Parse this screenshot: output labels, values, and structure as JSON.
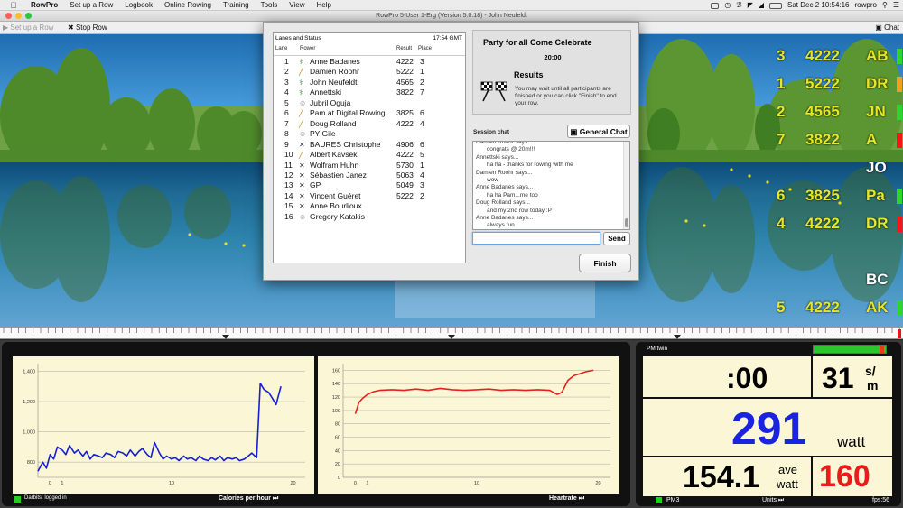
{
  "menubar": {
    "app": "RowPro",
    "items": [
      "Set up a Row",
      "Logbook",
      "Online Rowing",
      "Training",
      "Tools",
      "View",
      "Help"
    ],
    "clock": "Sat Dec 2  10:54:16",
    "user": "rowpro"
  },
  "window": {
    "title": "RowPro 5-User 1-Erg (Version 5.0.18) - John Neufeldt"
  },
  "toolbar": {
    "setup": "Set up a Row",
    "stop": "Stop Row",
    "chat": "Chat"
  },
  "dialog": {
    "lanes_title": "Lanes and Status",
    "time": "17:54 GMT",
    "headers": {
      "lane": "Lane",
      "rower": "Rower",
      "result": "Result",
      "place": "Place"
    },
    "rows": [
      {
        "lane": "1",
        "rower": "Anne Badanes",
        "result": "4222",
        "place": "3",
        "icon": "rowing"
      },
      {
        "lane": "2",
        "rower": "Damien Roohr",
        "result": "5222",
        "place": "1",
        "icon": "oar"
      },
      {
        "lane": "3",
        "rower": "John Neufeldt",
        "result": "4565",
        "place": "2",
        "icon": "rowing"
      },
      {
        "lane": "4",
        "rower": "Annettski",
        "result": "3822",
        "place": "7",
        "icon": "rowing"
      },
      {
        "lane": "5",
        "rower": "Jubril Oguja",
        "result": "",
        "place": "",
        "icon": "person"
      },
      {
        "lane": "6",
        "rower": "Pam at Digital Rowing",
        "result": "3825",
        "place": "6",
        "icon": "oar"
      },
      {
        "lane": "7",
        "rower": "Doug Rolland",
        "result": "4222",
        "place": "4",
        "icon": "oar"
      },
      {
        "lane": "8",
        "rower": "PY Gile",
        "result": "",
        "place": "",
        "icon": "person"
      },
      {
        "lane": "9",
        "rower": "BAURES Christophe",
        "result": "4906",
        "place": "6",
        "icon": "cross"
      },
      {
        "lane": "10",
        "rower": "Albert Kavsek",
        "result": "4222",
        "place": "5",
        "icon": "oar"
      },
      {
        "lane": "11",
        "rower": "Wolfram Huhn",
        "result": "5730",
        "place": "1",
        "icon": "cross"
      },
      {
        "lane": "12",
        "rower": "Sébastien Janez",
        "result": "5063",
        "place": "4",
        "icon": "cross"
      },
      {
        "lane": "13",
        "rower": "GP",
        "result": "5049",
        "place": "3",
        "icon": "cross"
      },
      {
        "lane": "14",
        "rower": "Vincent Guéret",
        "result": "5222",
        "place": "2",
        "icon": "cross"
      },
      {
        "lane": "15",
        "rower": "Anne Bourlioux",
        "result": "",
        "place": "",
        "icon": "cross"
      },
      {
        "lane": "16",
        "rower": "Gregory Katakis",
        "result": "",
        "place": "",
        "icon": "person"
      }
    ],
    "event": "Party for all Come Celebrate",
    "event_time": "20:00",
    "results_title": "Results",
    "results_msg": "You may wait until all participants are finished or you can click \"Finish\" to end your row.",
    "session_chat": "Session chat",
    "general_chat": "General Chat",
    "chat": [
      {
        "who": "Damien Roohr says...",
        "msg": "congrats @ 20m!!!"
      },
      {
        "who": "Annettski says...",
        "msg": "ha ha - thanks for rowing with me"
      },
      {
        "who": "Damien Roohr says...",
        "msg": "wow"
      },
      {
        "who": "Anne Badanes says...",
        "msg": "ha ha Pam...me too"
      },
      {
        "who": "Doug Rolland says...",
        "msg": "and my 2nd row today :P"
      },
      {
        "who": "Anne Badanes says...",
        "msg": "always fun"
      }
    ],
    "send": "Send",
    "finish": "Finish"
  },
  "scoreboard": [
    {
      "place": "3",
      "result": "4222",
      "initials": "AB",
      "flag": "#2fd42f"
    },
    {
      "place": "1",
      "result": "5222",
      "initials": "DR",
      "flag": "#f0a020"
    },
    {
      "place": "2",
      "result": "4565",
      "initials": "JN",
      "flag": "#2fd42f"
    },
    {
      "place": "7",
      "result": "3822",
      "initials": "A",
      "flag": "#f01818"
    },
    {
      "place": "",
      "result": "",
      "initials": "JO",
      "flag": ""
    },
    {
      "place": "6",
      "result": "3825",
      "initials": "Pa",
      "flag": "#2fd42f"
    },
    {
      "place": "4",
      "result": "4222",
      "initials": "DR",
      "flag": "#f01818"
    },
    {
      "place": "",
      "result": "",
      "initials": "",
      "flag": ""
    },
    {
      "place": "",
      "result": "",
      "initials": "BC",
      "flag": ""
    },
    {
      "place": "5",
      "result": "4222",
      "initials": "AK",
      "flag": "#2fd42f"
    }
  ],
  "bottom": {
    "status": "Darbits: logged in",
    "chart1_label": "Calories per hour",
    "chart2_label": "Heartrate"
  },
  "stats": {
    "pm": "PM twin",
    "time": ":00",
    "spm": "31",
    "spm_unit_top": "s/",
    "spm_unit_bot": "m",
    "watts": "291",
    "watt_unit": "watt",
    "avg": "154.1",
    "avg_unit_top": "ave",
    "avg_unit_bot": "watt",
    "hr": "160",
    "pm3": "PM3",
    "units": "Units",
    "fps": "fps:56"
  },
  "chart_data": [
    {
      "type": "line",
      "title": "",
      "xlabel": "Calories per hour",
      "ylabel": "",
      "xlim": [
        -1,
        21
      ],
      "ylim": [
        700,
        1450
      ],
      "xticks": [
        0,
        1,
        10,
        20
      ],
      "yticks": [
        800,
        1000,
        1200,
        1400
      ],
      "yticklabels": [
        "800",
        "1,000",
        "1,200",
        "1,400"
      ],
      "series": [
        {
          "color": "#1520d0",
          "points": [
            [
              -1,
              740
            ],
            [
              -0.6,
              800
            ],
            [
              -0.3,
              760
            ],
            [
              0,
              850
            ],
            [
              0.3,
              820
            ],
            [
              0.6,
              900
            ],
            [
              1,
              880
            ],
            [
              1.3,
              850
            ],
            [
              1.6,
              910
            ],
            [
              2,
              860
            ],
            [
              2.3,
              880
            ],
            [
              2.7,
              840
            ],
            [
              3,
              870
            ],
            [
              3.3,
              820
            ],
            [
              3.6,
              850
            ],
            [
              4,
              840
            ],
            [
              4.3,
              830
            ],
            [
              4.6,
              860
            ],
            [
              5,
              850
            ],
            [
              5.3,
              830
            ],
            [
              5.6,
              870
            ],
            [
              6,
              860
            ],
            [
              6.3,
              840
            ],
            [
              6.6,
              880
            ],
            [
              7,
              840
            ],
            [
              7.3,
              870
            ],
            [
              7.6,
              890
            ],
            [
              8,
              850
            ],
            [
              8.3,
              830
            ],
            [
              8.6,
              930
            ],
            [
              9,
              860
            ],
            [
              9.3,
              820
            ],
            [
              9.6,
              840
            ],
            [
              10,
              820
            ],
            [
              10.3,
              830
            ],
            [
              10.6,
              810
            ],
            [
              11,
              840
            ],
            [
              11.3,
              820
            ],
            [
              11.6,
              830
            ],
            [
              12,
              810
            ],
            [
              12.3,
              840
            ],
            [
              12.6,
              820
            ],
            [
              13,
              810
            ],
            [
              13.3,
              830
            ],
            [
              13.6,
              815
            ],
            [
              14,
              840
            ],
            [
              14.3,
              810
            ],
            [
              14.6,
              830
            ],
            [
              15,
              820
            ],
            [
              15.3,
              830
            ],
            [
              15.6,
              810
            ],
            [
              16,
              820
            ],
            [
              16.3,
              840
            ],
            [
              16.6,
              860
            ],
            [
              17,
              830
            ],
            [
              17.3,
              1320
            ],
            [
              17.6,
              1280
            ],
            [
              18,
              1260
            ],
            [
              18.3,
              1220
            ],
            [
              18.6,
              1180
            ],
            [
              19,
              1300
            ]
          ]
        }
      ]
    },
    {
      "type": "line",
      "title": "",
      "xlabel": "Heartrate",
      "ylabel": "",
      "xlim": [
        -1,
        21
      ],
      "ylim": [
        0,
        170
      ],
      "xticks": [
        0,
        1,
        10,
        20
      ],
      "yticks": [
        0,
        20,
        40,
        60,
        80,
        100,
        120,
        140,
        160
      ],
      "series": [
        {
          "color": "#e8201c",
          "points": [
            [
              0,
              95
            ],
            [
              0.3,
              112
            ],
            [
              0.6,
              118
            ],
            [
              1,
              124
            ],
            [
              1.5,
              128
            ],
            [
              2,
              130
            ],
            [
              3,
              131
            ],
            [
              4,
              130
            ],
            [
              5,
              132
            ],
            [
              6,
              130
            ],
            [
              7,
              133
            ],
            [
              8,
              131
            ],
            [
              9,
              130
            ],
            [
              10,
              131
            ],
            [
              11,
              132
            ],
            [
              12,
              130
            ],
            [
              13,
              131
            ],
            [
              14,
              130
            ],
            [
              15,
              131
            ],
            [
              16,
              130
            ],
            [
              16.6,
              124
            ],
            [
              17,
              127
            ],
            [
              17.5,
              145
            ],
            [
              18,
              152
            ],
            [
              19,
              158
            ],
            [
              19.6,
              160
            ]
          ]
        }
      ]
    }
  ]
}
